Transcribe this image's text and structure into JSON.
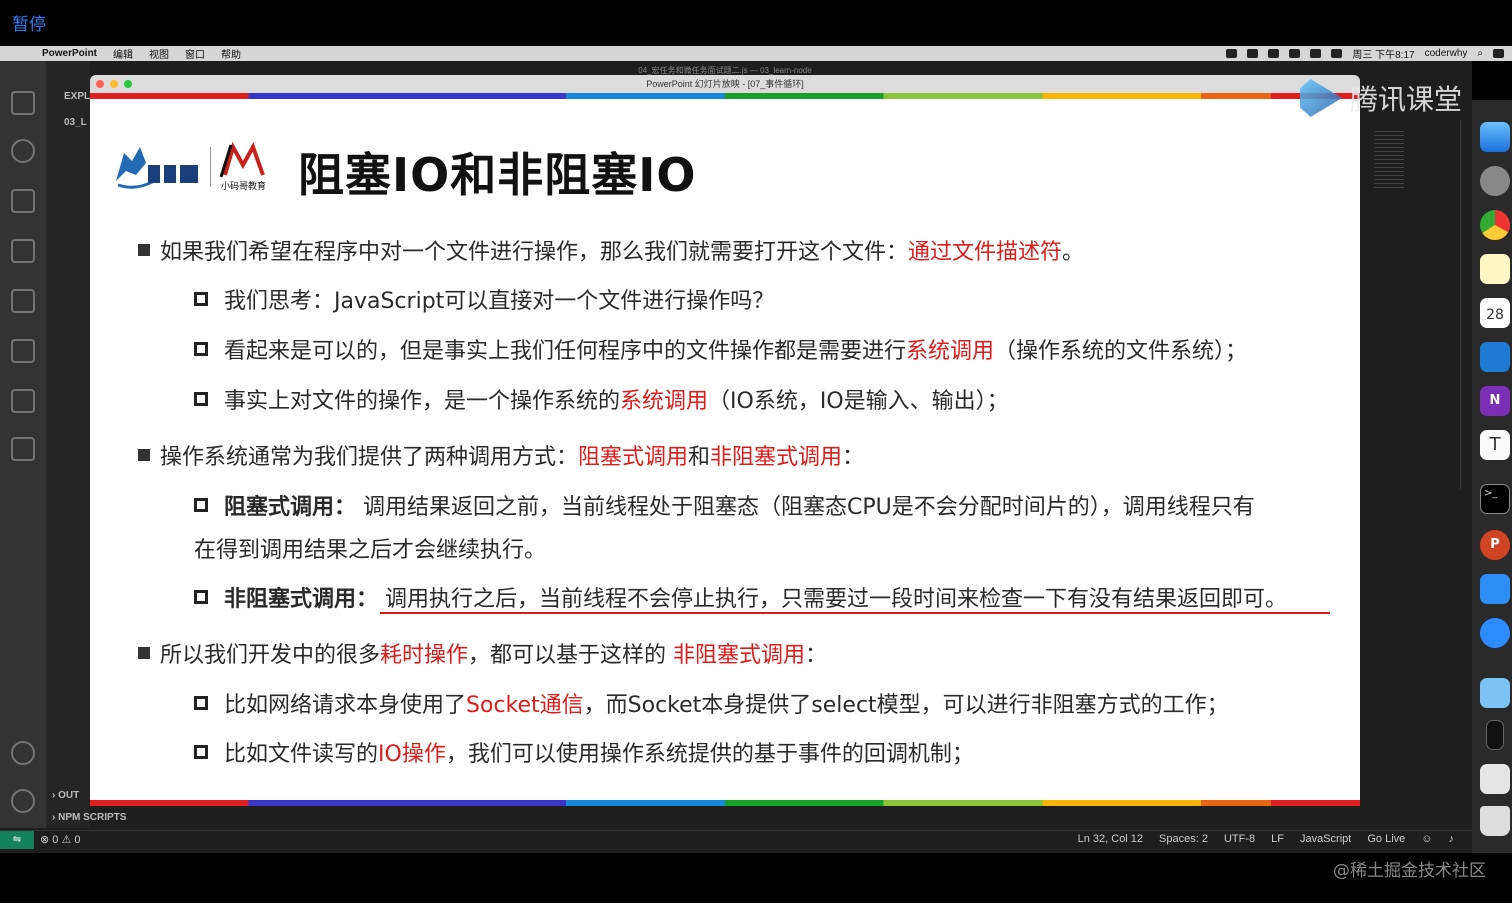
{
  "player": {
    "pause_label": "暂停"
  },
  "menubar": {
    "app": "PowerPoint",
    "items": [
      "编辑",
      "视图",
      "窗口",
      "帮助"
    ],
    "clock": "周三 下午8:17",
    "user": "coderwhy"
  },
  "vscode": {
    "explorer_label": "EXPL",
    "folder_label": "03_L",
    "outline_label": "OUT",
    "npm_scripts_label": "NPM SCRIPTS",
    "problems": "⊗ 0 ⚠ 0",
    "status": {
      "position": "Ln 32, Col 12",
      "spaces": "Spaces: 2",
      "encoding": "UTF-8",
      "eol": "LF",
      "language": "JavaScript",
      "golive": "Go Live"
    }
  },
  "powerpoint": {
    "window_subtitle": "04_宏任务和微任务面试题二.js — 03_learn-node",
    "window_title": "PowerPoint 幻灯片放映 - [07_事件循环]"
  },
  "slide": {
    "title": "阻塞IO和非阻塞IO",
    "logo_small_text": "小码哥教育",
    "b1": {
      "text": "如果我们希望在程序中对一个文件进行操作，那么我们就需要打开这个文件：",
      "red": "通过文件描述符",
      "tail": "。"
    },
    "b1_1": "我们思考：JavaScript可以直接对一个文件进行操作吗？",
    "b1_2": {
      "pre": "看起来是可以的，但是事实上我们任何程序中的文件操作都是需要进行",
      "red": "系统调用",
      "tail": "（操作系统的文件系统）；"
    },
    "b1_3": {
      "pre": "事实上对文件的操作，是一个操作系统的",
      "red": "系统调用",
      "tail": "（IO系统，IO是输入、输出）；"
    },
    "b2": {
      "pre": "操作系统通常为我们提供了两种调用方式：",
      "red1": "阻塞式调用",
      "mid": "和",
      "red2": "非阻塞式调用",
      "tail": "："
    },
    "b2_1": {
      "bold": "阻塞式调用：",
      "text": " 调用结果返回之前，当前线程处于阻塞态（阻塞态CPU是不会分配时间片的），调用线程只有",
      "cont": "在得到调用结果之后才会继续执行。"
    },
    "b2_2": {
      "bold": "非阻塞式调用：",
      "text": " 调用执行之后，当前线程不会停止执行，只需要过一段时间来检查一下有没有结果返回即可。"
    },
    "b3": {
      "pre": "所以我们开发中的很多",
      "red1": "耗时操作",
      "mid": "，都可以基于这样的 ",
      "red2": "非阻塞式调用",
      "tail": "："
    },
    "b3_1": {
      "pre": "比如网络请求本身使用了",
      "red": "Socket通信",
      "tail": "，而Socket本身提供了select模型，可以进行非阻塞方式的工作；"
    },
    "b3_2": {
      "pre": "比如文件读写的",
      "red": "IO操作",
      "tail": "，我们可以使用操作系统提供的基于事件的回调机制；"
    }
  },
  "watermarks": {
    "tencent": "腾讯课堂",
    "juejin": "@稀土掘金技术社区"
  },
  "dock": {
    "calendar_day": "28",
    "onenote_letter": "N",
    "typora_letter": "T",
    "ppt_letter": "P"
  },
  "colors": {
    "highlight_red": "#e01b1b",
    "vscode_bg": "#1e1e1e"
  }
}
